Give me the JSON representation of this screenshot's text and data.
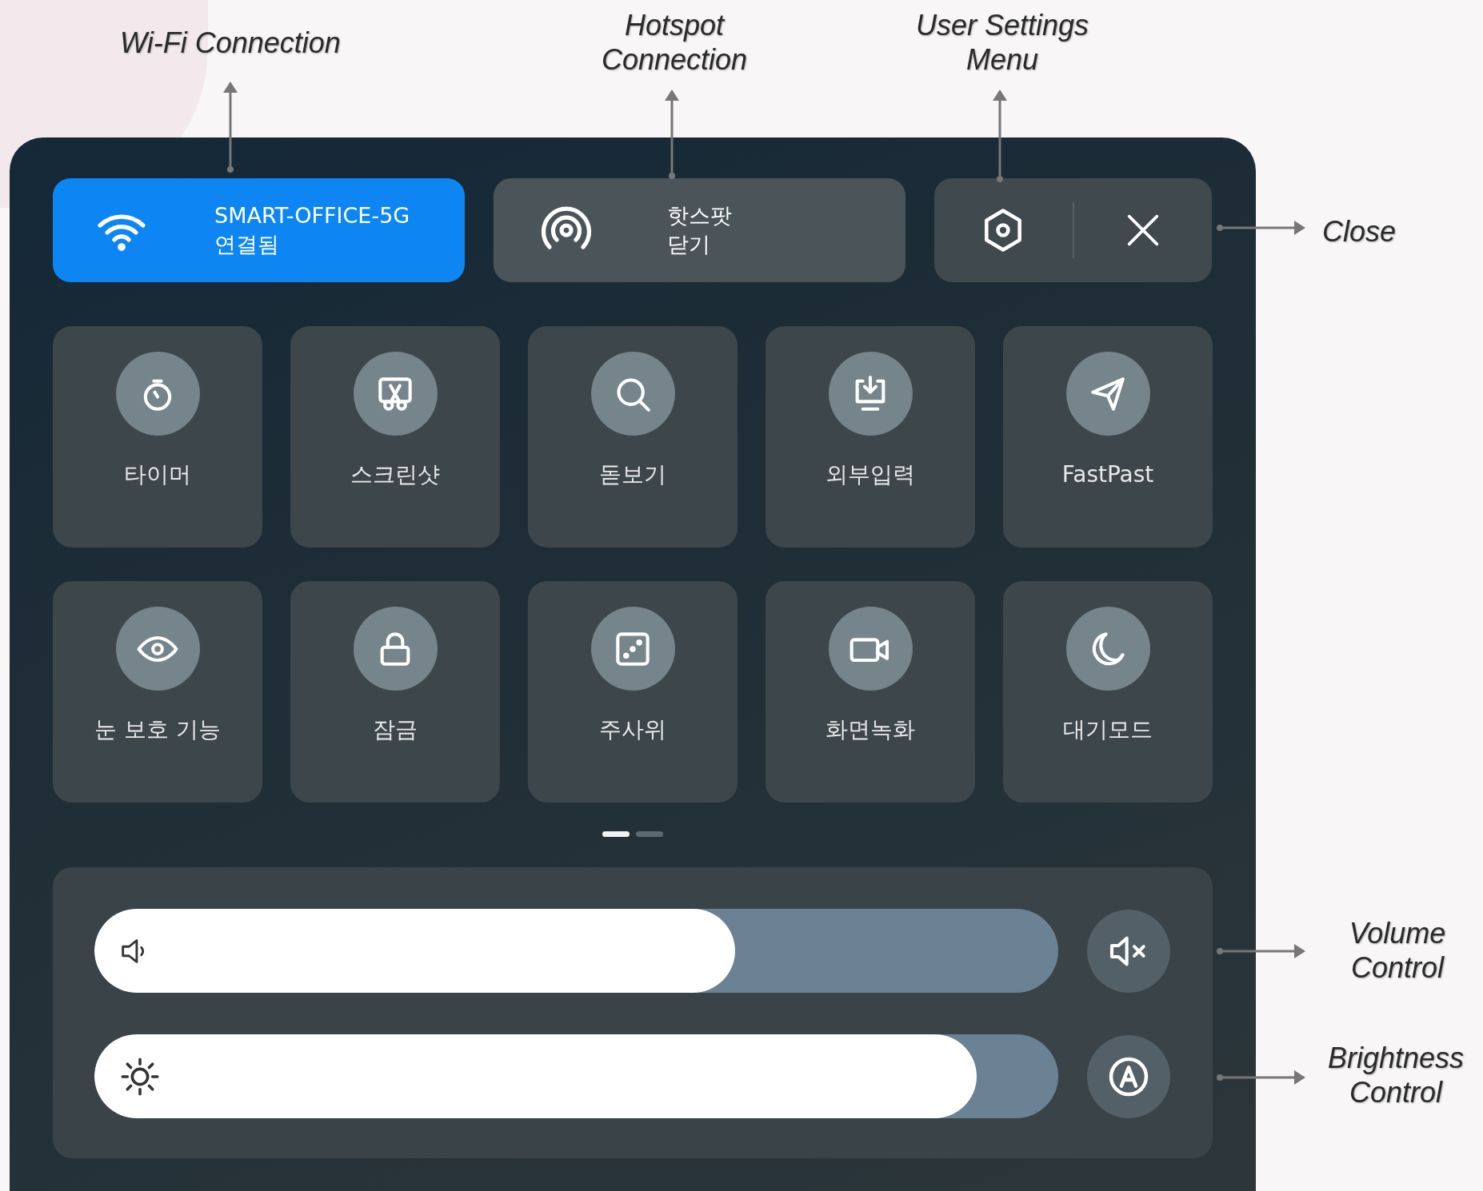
{
  "annotations": [
    {
      "text": "Wi-Fi Connection"
    },
    {
      "text": "Hotspot Connection"
    },
    {
      "text": "User Settings Menu"
    },
    {
      "text": "Close"
    },
    {
      "text": "Volume Control"
    },
    {
      "text": "Brightness Control"
    }
  ],
  "connections": [
    {
      "kind": "wifi",
      "name": "SMART-OFFICE-5G",
      "status": "연결됨",
      "selected": true
    },
    {
      "kind": "hotspot",
      "name": "핫스팟",
      "status": "닫기",
      "selected": false
    }
  ],
  "tiles": [
    {
      "kind": "timer",
      "label": "타이머"
    },
    {
      "kind": "screenshot",
      "label": "스크린샷"
    },
    {
      "kind": "magnifier",
      "label": "돋보기"
    },
    {
      "kind": "input",
      "label": "외부입력"
    },
    {
      "kind": "send",
      "label": "FastPast"
    },
    {
      "kind": "eye",
      "label": "눈 보호 기능"
    },
    {
      "kind": "lock",
      "label": "잠금"
    },
    {
      "kind": "dice",
      "label": "주사위"
    },
    {
      "kind": "record",
      "label": "화면녹화"
    },
    {
      "kind": "moon",
      "label": "대기모드"
    }
  ],
  "pages": [
    {
      "selected": true
    },
    {
      "selected": false
    }
  ],
  "sliders": [
    {
      "kind": "volume",
      "level": 0.665
    },
    {
      "kind": "brightness",
      "level": 0.915
    }
  ]
}
